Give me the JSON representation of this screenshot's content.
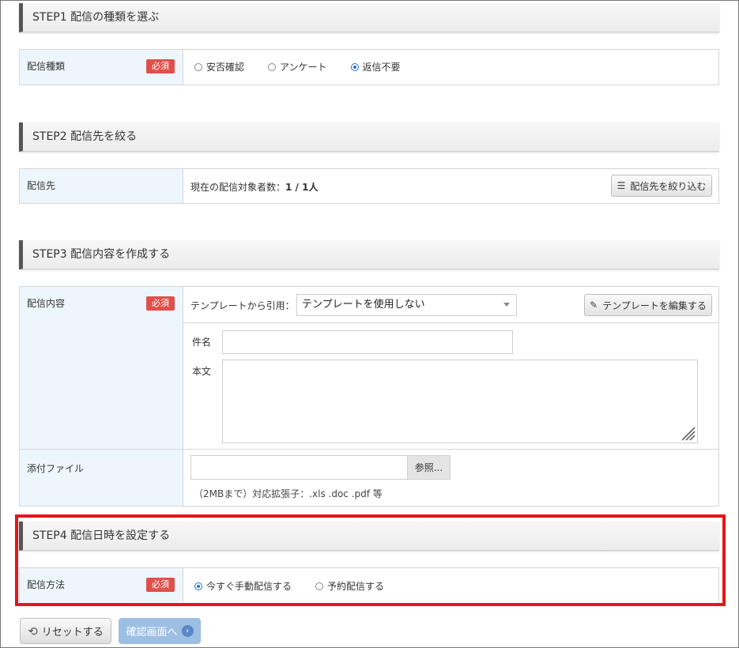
{
  "step1": {
    "title": "STEP1 配信の種類を選ぶ",
    "label": "配信種類",
    "required": "必須",
    "options": [
      "安否確認",
      "アンケート",
      "返信不要"
    ],
    "selected": "返信不要"
  },
  "step2": {
    "title": "STEP2 配信先を絞る",
    "label": "配信先",
    "count_text": "現在の配信対象者数：",
    "count_value": "1 / 1人",
    "filter_button": "配信先を絞り込む"
  },
  "step3": {
    "title": "STEP3 配信内容を作成する",
    "content_label": "配信内容",
    "required": "必須",
    "template_label": "テンプレートから引用：",
    "template_selected": "テンプレートを使用しない",
    "edit_template_button": "テンプレートを編集する",
    "subject_label": "件名",
    "subject_value": "",
    "body_label": "本文",
    "body_value": "",
    "attach_label": "添付ファイル",
    "browse_button": "参照...",
    "attach_note": "（2MBまで）対応拡張子：.xls .doc .pdf 等"
  },
  "step4": {
    "title": "STEP4 配信日時を設定する",
    "label": "配信方法",
    "required": "必須",
    "options": [
      "今すぐ手動配信する",
      "予約配信する"
    ],
    "selected": "今すぐ手動配信する"
  },
  "footer": {
    "reset_button": "リセットする",
    "confirm_button": "確認画面へ"
  },
  "colors": {
    "required_badge": "#e0504a",
    "highlight_frame": "#e8141b",
    "confirm_button": "#9dbfe3",
    "label_bg": "#eef6fd"
  }
}
